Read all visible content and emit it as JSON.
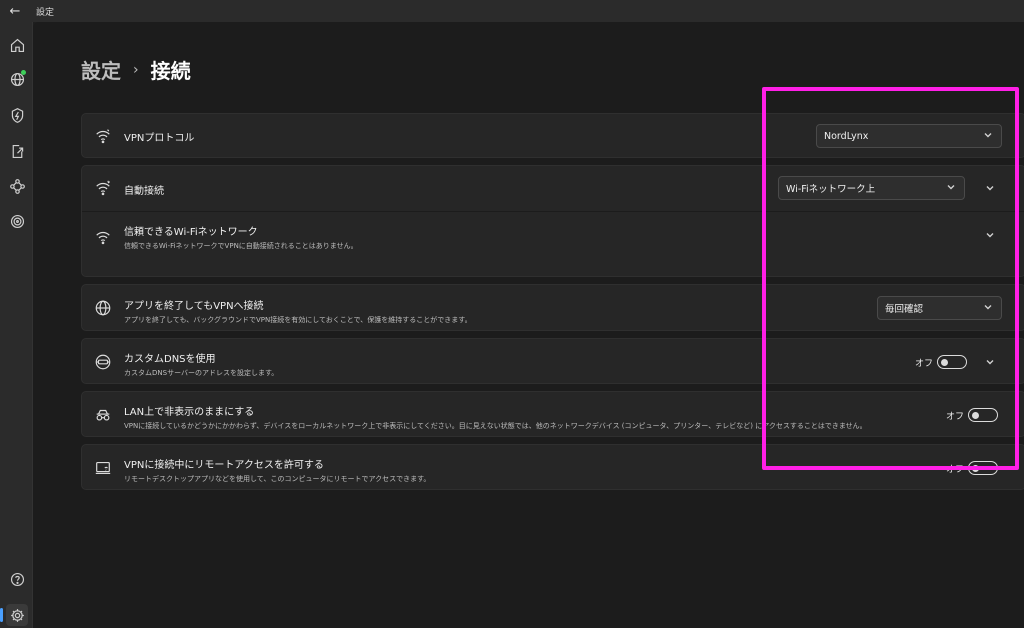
{
  "window": {
    "title": "設定",
    "back_glyph": "←"
  },
  "breadcrumb": {
    "parent": "設定",
    "separator": "›",
    "current": "接続"
  },
  "sidebar": {
    "items": [
      {
        "icon": "home-icon"
      },
      {
        "icon": "globe-icon"
      },
      {
        "icon": "shield-bolt-icon"
      },
      {
        "icon": "split-tunnel-icon"
      },
      {
        "icon": "meshnet-icon"
      },
      {
        "icon": "target-icon"
      },
      {
        "icon": "help-icon"
      },
      {
        "icon": "settings-icon"
      }
    ]
  },
  "settings": {
    "vpn_protocol": {
      "title": "VPNプロトコル",
      "value": "NordLynx"
    },
    "auto_connect": {
      "title": "自動接続",
      "value": "Wi-Fiネットワーク上"
    },
    "trusted_wifi": {
      "title": "信頼できるWi-Fiネットワーク",
      "desc": "信頼できるWi-FiネットワークでVPNに自動接続されることはありません。"
    },
    "keep_vpn": {
      "title": "アプリを終了してもVPNへ接続",
      "desc": "アプリを終了しても、バックグラウンドでVPN接続を有効にしておくことで、保護を維持することができます。",
      "value": "毎回確認"
    },
    "custom_dns": {
      "title": "カスタムDNSを使用",
      "desc": "カスタムDNSサーバーのアドレスを設定します。",
      "toggle_label": "オフ"
    },
    "invisible_lan": {
      "title": "LAN上で非表示のままにする",
      "desc": "VPNに接続しているかどうかにかかわらず、デバイスをローカルネットワーク上で非表示にしてください。目に見えない状態では、他のネットワークデバイス (コンピュータ、プリンター、テレビなど) にアクセスすることはできません。",
      "toggle_label": "オフ"
    },
    "remote_access": {
      "title": "VPNに接続中にリモートアクセスを許可する",
      "desc": "リモートデスクトップアプリなどを使用して、このコンピュータにリモートでアクセスできます。",
      "toggle_label": "オフ"
    }
  },
  "colors": {
    "highlight": "#ff1fe6",
    "accent": "#4aa0ff",
    "status_dot": "#3ecf5a"
  }
}
